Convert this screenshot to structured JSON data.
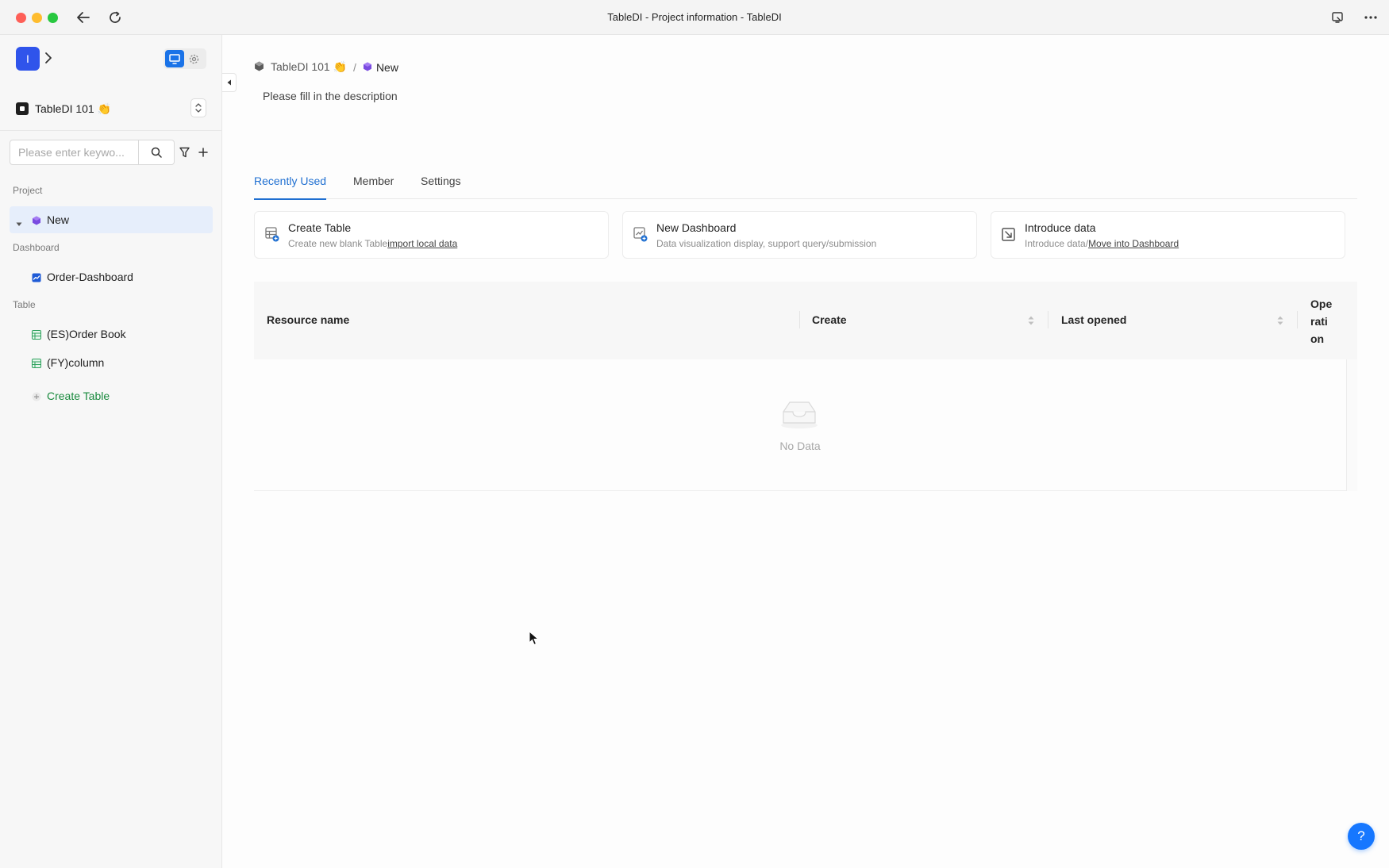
{
  "window": {
    "title": "TableDI - Project information - TableDI",
    "icons": [
      "back-arrow-icon",
      "refresh-icon",
      "cast-icon",
      "more-icon"
    ]
  },
  "sidebar": {
    "workspace_initial": "I",
    "project_name": "TableDI 101 👏",
    "search_placeholder": "Please enter keywo...",
    "sections": {
      "project": "Project",
      "dashboard": "Dashboard",
      "table": "Table"
    },
    "project_items": [
      {
        "label": "New",
        "active": true
      }
    ],
    "dashboard_items": [
      {
        "label": "Order-Dashboard"
      }
    ],
    "table_items": [
      {
        "label": "(ES)Order Book"
      },
      {
        "label": "(FY)column"
      }
    ],
    "create_table_label": "Create Table"
  },
  "main": {
    "breadcrumb": {
      "root": "TableDI 101 👏",
      "separator": "/",
      "current": "New"
    },
    "description": "Please fill in the description",
    "tabs": [
      {
        "label": "Recently Used",
        "active": true
      },
      {
        "label": "Member",
        "active": false
      },
      {
        "label": "Settings",
        "active": false
      }
    ],
    "cards": [
      {
        "title": "Create Table",
        "desc": "Create new blank Table",
        "link": "import local data"
      },
      {
        "title": "New Dashboard",
        "desc": "Data visualization display, support query/submission",
        "link": ""
      },
      {
        "title": "Introduce data",
        "desc": "Introduce data/",
        "link": "Move into Dashboard"
      }
    ],
    "table": {
      "columns": {
        "name": "Resource name",
        "create": "Create",
        "last_opened": "Last opened",
        "operation": "Ope\nrati\non"
      },
      "rows": [],
      "empty_text": "No Data"
    }
  },
  "help_label": "?",
  "colors": {
    "accent": "#1f6fd1",
    "create_green": "#1a8a3e",
    "help_blue": "#1677ff"
  }
}
